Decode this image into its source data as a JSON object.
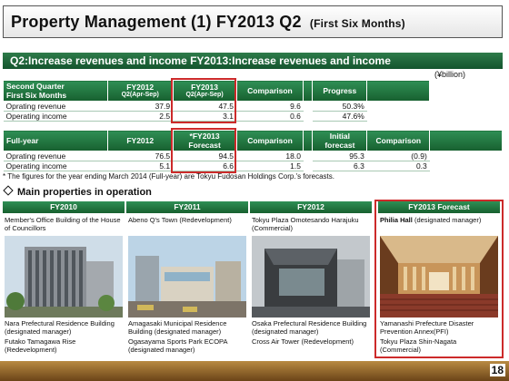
{
  "title": {
    "main": "Property Management (1) FY2013 Q2",
    "sub": "(First Six Months)"
  },
  "section_bar": "Q2:Increase revenues and income  FY2013:Increase revenues and income",
  "unit": "(¥billion)",
  "q2_table": {
    "header": {
      "label": "Second Quarter\nFirst Six Months",
      "fy2012": "FY2012",
      "fy2012_sub": "Q2(Apr-Sep)",
      "fy2013": "FY2013",
      "fy2013_sub": "Q2(Apr-Sep)",
      "comparison": "Comparison",
      "progress": "Progress"
    },
    "rows": [
      {
        "label": "Oprating revenue",
        "fy2012": "37.9",
        "fy2013": "47.5",
        "comparison": "9.6",
        "progress": "50.3%"
      },
      {
        "label": "Operating income",
        "fy2012": "2.5",
        "fy2013": "3.1",
        "comparison": "0.6",
        "progress": "47.6%"
      }
    ]
  },
  "fy_table": {
    "header": {
      "label": "Full-year",
      "fy2012": "FY2012",
      "fy2013": "*FY2013\nForecast",
      "comparison": "Comparison",
      "initial": "Initial\nforecast",
      "comparison2": "Comparison"
    },
    "rows": [
      {
        "label": "Oprating revenue",
        "fy2012": "76.5",
        "fy2013": "94.5",
        "comparison": "18.0",
        "initial": "95.3",
        "comparison2": "(0.9)"
      },
      {
        "label": "Operating income",
        "fy2012": "5.1",
        "fy2013": "6.6",
        "comparison": "1.5",
        "initial": "6.3",
        "comparison2": "0.3"
      }
    ]
  },
  "footnote": "* The figures for the year ending March 2014 (Full-year) are Tokyu Fudosan Holdings Corp.'s forecasts.",
  "main_heading": "Main properties in operation",
  "columns": [
    {
      "header": "FY2010",
      "top": "Member's Office Building of the House of Councillors",
      "bottom": [
        "Nara Prefectural Residence Building (designated manager)",
        "Futako Tamagawa Rise (Redevelopment)"
      ]
    },
    {
      "header": "FY2011",
      "top": "Abeno Q's Town (Redevelopment)",
      "bottom": [
        "Amagasaki Municipal Residence Building (designated manager)",
        "Ogasayama Sports Park ECOPA (designated manager)"
      ]
    },
    {
      "header": "FY2012",
      "top": "Tokyu Plaza Omotesando Harajuku (Commercial)",
      "bottom": [
        "Osaka Prefectural Residence Building (designated manager)",
        "Cross Air Tower (Redevelopment)"
      ]
    },
    {
      "header": "FY2013 Forecast",
      "top_bold": "Philia Hall",
      "top": " (designated manager)",
      "bottom": [
        "Yamanashi Prefecture Disaster Prevention Annex(PFI)",
        "Tokyu Plaza Shin-Nagata (Commercial)"
      ]
    }
  ],
  "colors": {
    "green": "#17602f",
    "red": "#cc2a2a",
    "footer": "#8a5d26"
  },
  "page_number": "18"
}
